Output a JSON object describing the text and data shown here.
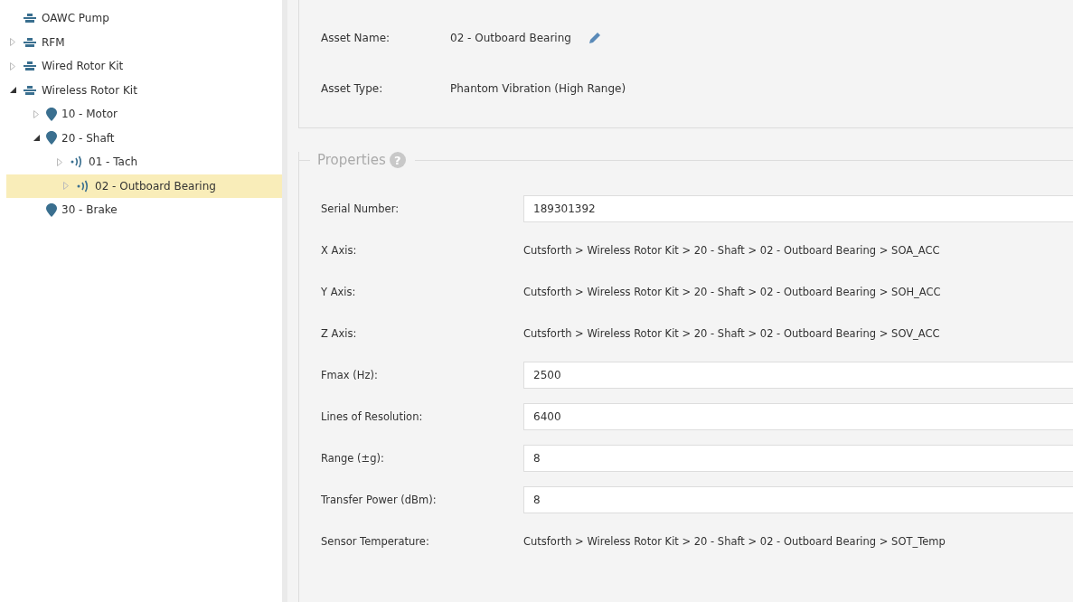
{
  "tree": [
    {
      "label": "OAWC Pump",
      "kind": "machine",
      "selected": false
    },
    {
      "label": "RFM",
      "kind": "machine",
      "expanded": false,
      "selected": false
    },
    {
      "label": "Wired Rotor Kit",
      "kind": "machine",
      "expanded": false,
      "selected": false
    },
    {
      "label": "Wireless Rotor Kit",
      "kind": "machine",
      "expanded": true,
      "selected": false,
      "children": [
        {
          "label": "10 - Motor",
          "kind": "location",
          "expanded": false,
          "selected": false
        },
        {
          "label": "20 - Shaft",
          "kind": "location",
          "expanded": true,
          "selected": false,
          "children": [
            {
              "label": "01 - Tach",
              "kind": "sensor",
              "expanded": false,
              "selected": false
            },
            {
              "label": "02 - Outboard Bearing",
              "kind": "sensor",
              "expanded": false,
              "selected": true
            }
          ]
        },
        {
          "label": "30 - Brake",
          "kind": "location",
          "selected": false
        }
      ]
    }
  ],
  "settings": {
    "asset_name_label": "Asset Name:",
    "asset_name": "02 - Outboard Bearing",
    "asset_type_label": "Asset Type:",
    "asset_type": "Phantom Vibration (High Range)"
  },
  "properties": {
    "title": "Properties",
    "help": "?",
    "rows": [
      {
        "kind": "field",
        "label": "Serial Number:",
        "value": "189301392"
      },
      {
        "kind": "text",
        "label": "X Axis:",
        "value": "Cutsforth > Wireless Rotor Kit > 20 - Shaft > 02 - Outboard Bearing > SOA_ACC"
      },
      {
        "kind": "text",
        "label": "Y Axis:",
        "value": "Cutsforth > Wireless Rotor Kit > 20 - Shaft > 02 - Outboard Bearing > SOH_ACC"
      },
      {
        "kind": "text",
        "label": "Z Axis:",
        "value": "Cutsforth > Wireless Rotor Kit > 20 - Shaft > 02 - Outboard Bearing > SOV_ACC"
      },
      {
        "kind": "field",
        "label": "Fmax (Hz):",
        "value": "2500"
      },
      {
        "kind": "field",
        "label": "Lines of Resolution:",
        "value": "6400"
      },
      {
        "kind": "field",
        "label": "Range (±g):",
        "value": "8"
      },
      {
        "kind": "field",
        "label": "Transfer Power (dBm):",
        "value": "8"
      },
      {
        "kind": "text",
        "label": "Sensor Temperature:",
        "value": "Cutsforth > Wireless Rotor Kit > 20 - Shaft > 02 - Outboard Bearing > SOT_Temp"
      }
    ]
  }
}
